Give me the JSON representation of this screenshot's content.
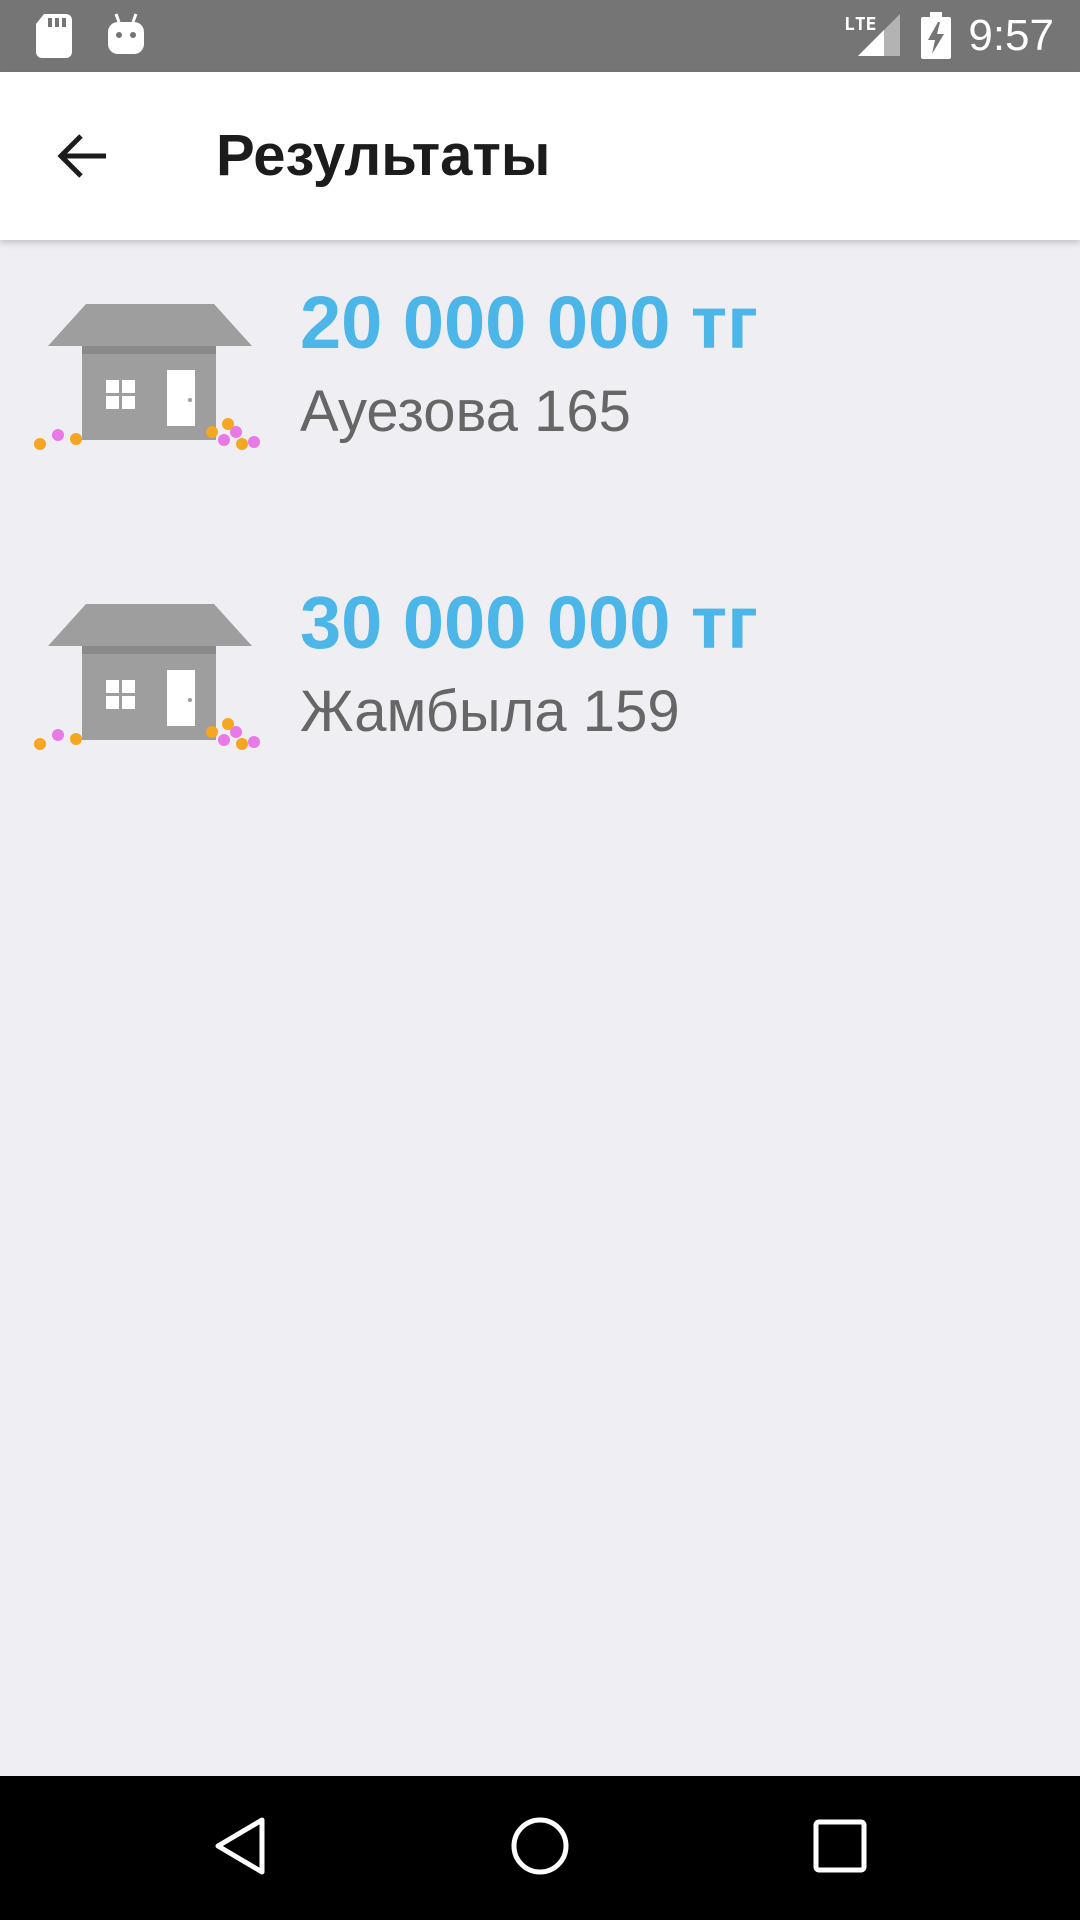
{
  "status_bar": {
    "time": "9:57",
    "icons": [
      "sd-card-icon",
      "android-icon",
      "lte-signal-icon",
      "battery-charging-icon"
    ]
  },
  "app_bar": {
    "back_icon": "arrow-back-icon",
    "title": "Результаты"
  },
  "results": [
    {
      "price": "20 000 000 тг",
      "address": "Ауезова 165",
      "icon": "house-icon"
    },
    {
      "price": "30 000 000 тг",
      "address": "Жамбыла 159",
      "icon": "house-icon"
    }
  ],
  "nav_bar": {
    "icons": [
      "back-triangle-icon",
      "home-circle-icon",
      "recents-square-icon"
    ]
  },
  "colors": {
    "price": "#4CB6E8",
    "status_bar": "#757575",
    "background": "#EFEEF3"
  }
}
